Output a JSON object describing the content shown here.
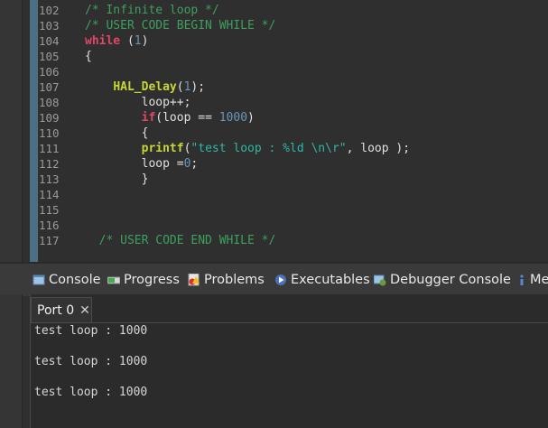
{
  "editor": {
    "lines": [
      {
        "num": "102",
        "code": [
          {
            "t": "/* Infinite loop */",
            "c": "cmt"
          }
        ]
      },
      {
        "num": "103",
        "code": [
          {
            "t": "/* USER CODE BEGIN WHILE */",
            "c": "cmt"
          }
        ]
      },
      {
        "num": "104",
        "code": [
          {
            "t": "while",
            "c": "kw"
          },
          {
            "t": " (",
            "c": "pl"
          },
          {
            "t": "1",
            "c": "num"
          },
          {
            "t": ")",
            "c": "pl"
          }
        ]
      },
      {
        "num": "105",
        "code": [
          {
            "t": "{",
            "c": "pl"
          }
        ]
      },
      {
        "num": "106",
        "code": []
      },
      {
        "num": "107",
        "code": [
          {
            "t": "    ",
            "c": "pl"
          },
          {
            "t": "HAL_Delay",
            "c": "fn"
          },
          {
            "t": "(",
            "c": "pl"
          },
          {
            "t": "1",
            "c": "num"
          },
          {
            "t": ");",
            "c": "pl"
          }
        ]
      },
      {
        "num": "108",
        "code": [
          {
            "t": "        loop++;",
            "c": "pl"
          }
        ]
      },
      {
        "num": "109",
        "code": [
          {
            "t": "        ",
            "c": "pl"
          },
          {
            "t": "if",
            "c": "kw"
          },
          {
            "t": "(loop == ",
            "c": "pl"
          },
          {
            "t": "1000",
            "c": "num"
          },
          {
            "t": ")",
            "c": "pl"
          }
        ]
      },
      {
        "num": "110",
        "code": [
          {
            "t": "        {",
            "c": "pl"
          }
        ]
      },
      {
        "num": "111",
        "code": [
          {
            "t": "        ",
            "c": "pl"
          },
          {
            "t": "printf",
            "c": "fn"
          },
          {
            "t": "(",
            "c": "pl"
          },
          {
            "t": "\"test loop : %ld \\n\\r\"",
            "c": "str"
          },
          {
            "t": ", loop );",
            "c": "pl"
          }
        ]
      },
      {
        "num": "112",
        "code": [
          {
            "t": "        loop =",
            "c": "pl"
          },
          {
            "t": "0",
            "c": "num"
          },
          {
            "t": ";",
            "c": "pl"
          }
        ]
      },
      {
        "num": "113",
        "code": [
          {
            "t": "        }",
            "c": "pl"
          }
        ]
      },
      {
        "num": "114",
        "code": []
      },
      {
        "num": "115",
        "code": []
      },
      {
        "num": "116",
        "code": []
      },
      {
        "num": "117",
        "code": [
          {
            "t": "  /* USER CODE END WHILE */",
            "c": "cmt"
          }
        ]
      }
    ]
  },
  "views": {
    "tabs": [
      {
        "label": "Console",
        "icon": "console-icon"
      },
      {
        "label": "Progress",
        "icon": "progress-icon"
      },
      {
        "label": "Problems",
        "icon": "problems-icon"
      },
      {
        "label": "Executables",
        "icon": "executables-icon"
      },
      {
        "label": "Debugger Console",
        "icon": "debugger-console-icon"
      },
      {
        "label": "Me",
        "icon": "memory-icon"
      }
    ]
  },
  "console": {
    "port_tab": "Port 0",
    "close_glyph": "✕",
    "output": [
      "test loop : 1000",
      "",
      "test loop : 1000",
      "",
      "test loop : 1000"
    ]
  },
  "colors": {
    "comment": "#3f9f5f",
    "keyword": "#e04665",
    "number": "#6897bb",
    "function": "#c6d638",
    "string": "#2fb7a6",
    "ruler": "#4d6f86"
  }
}
